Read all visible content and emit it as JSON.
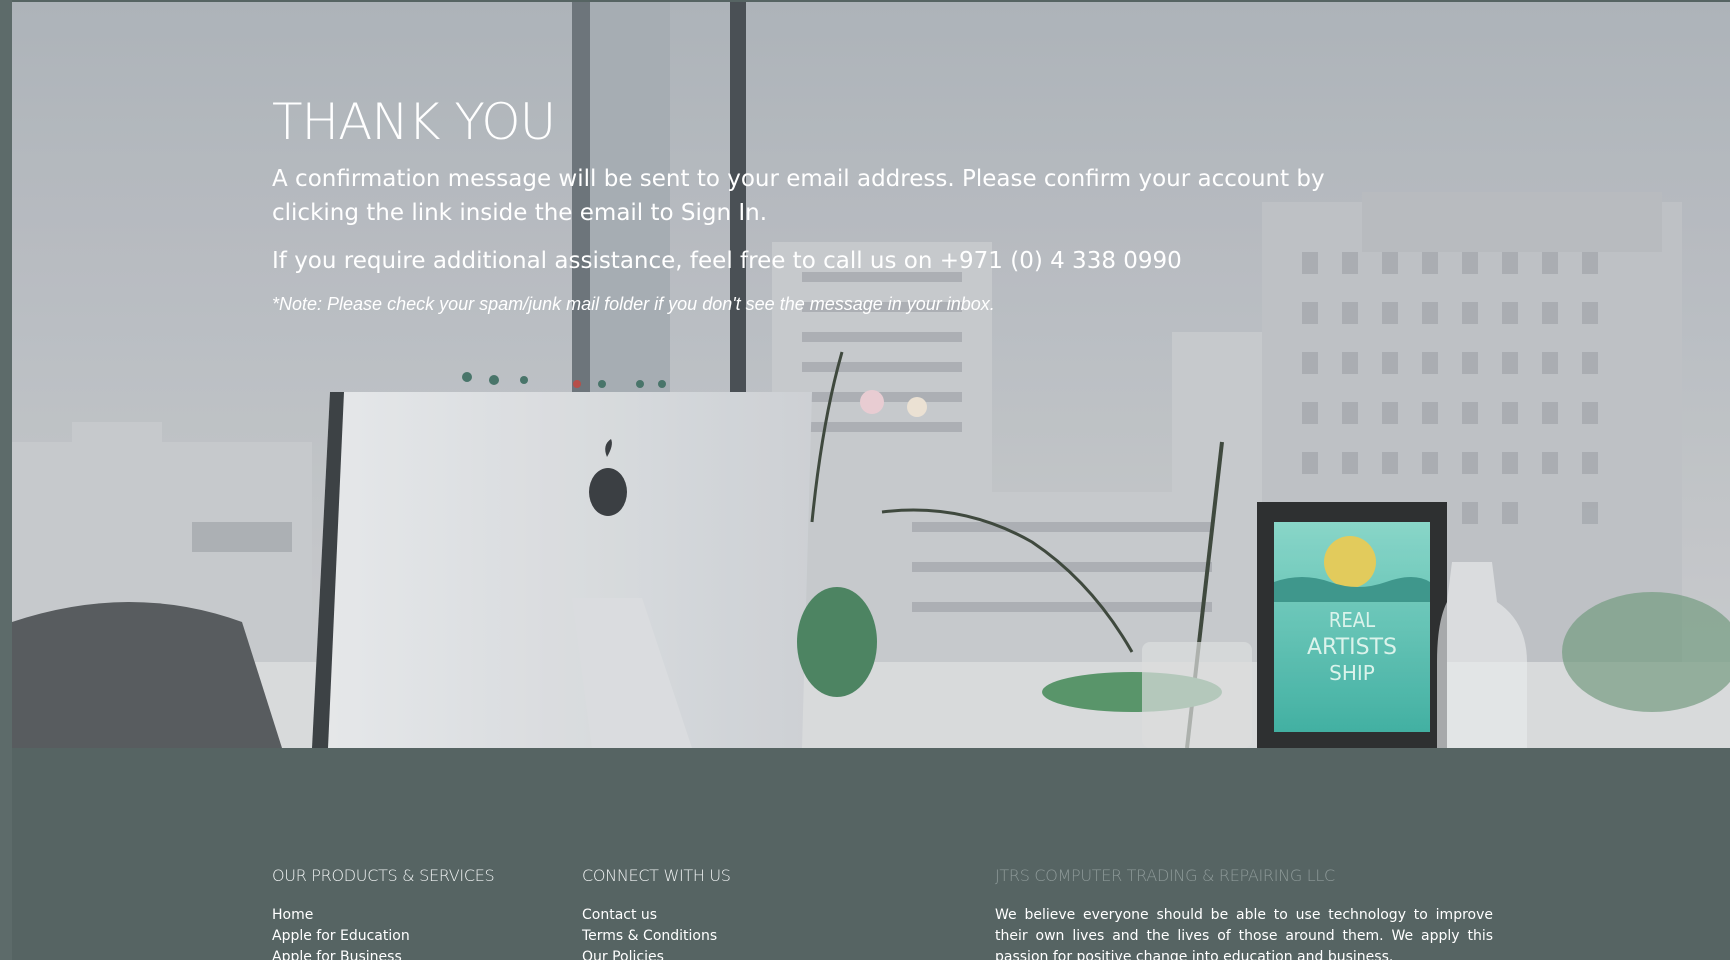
{
  "hero": {
    "title": "THANK YOU",
    "message": "A confirmation message will be sent to your email address. Please confirm your account by clicking the link inside the email to Sign In.",
    "assistance": "If you require additional assistance, feel free to call us on +971 (0) 4 338 0990",
    "note": "*Note: Please check your spam/junk mail folder if you don't see the message in your inbox.",
    "frame_poster_text": [
      "REAL",
      "ARTISTS",
      "SHIP"
    ]
  },
  "footer": {
    "products": {
      "heading": "OUR PRODUCTS & SERVICES",
      "links": [
        "Home",
        "Apple for Education",
        "Apple for Business"
      ]
    },
    "connect": {
      "heading": "CONNECT WITH US",
      "links": [
        "Contact us",
        "Terms & Conditions",
        "Our Policies"
      ]
    },
    "company": {
      "heading": "JTRS COMPUTER TRADING & REPAIRING LLC",
      "about": "We believe everyone should be able to use technology to improve their own lives and the lives of those around them. We apply this passion for positive change into education and business."
    }
  },
  "colors": {
    "footer_bg": "#566463",
    "company_heading": "#8e9a99",
    "text": "#ffffff",
    "poster_teal": "#3cb8a8"
  }
}
